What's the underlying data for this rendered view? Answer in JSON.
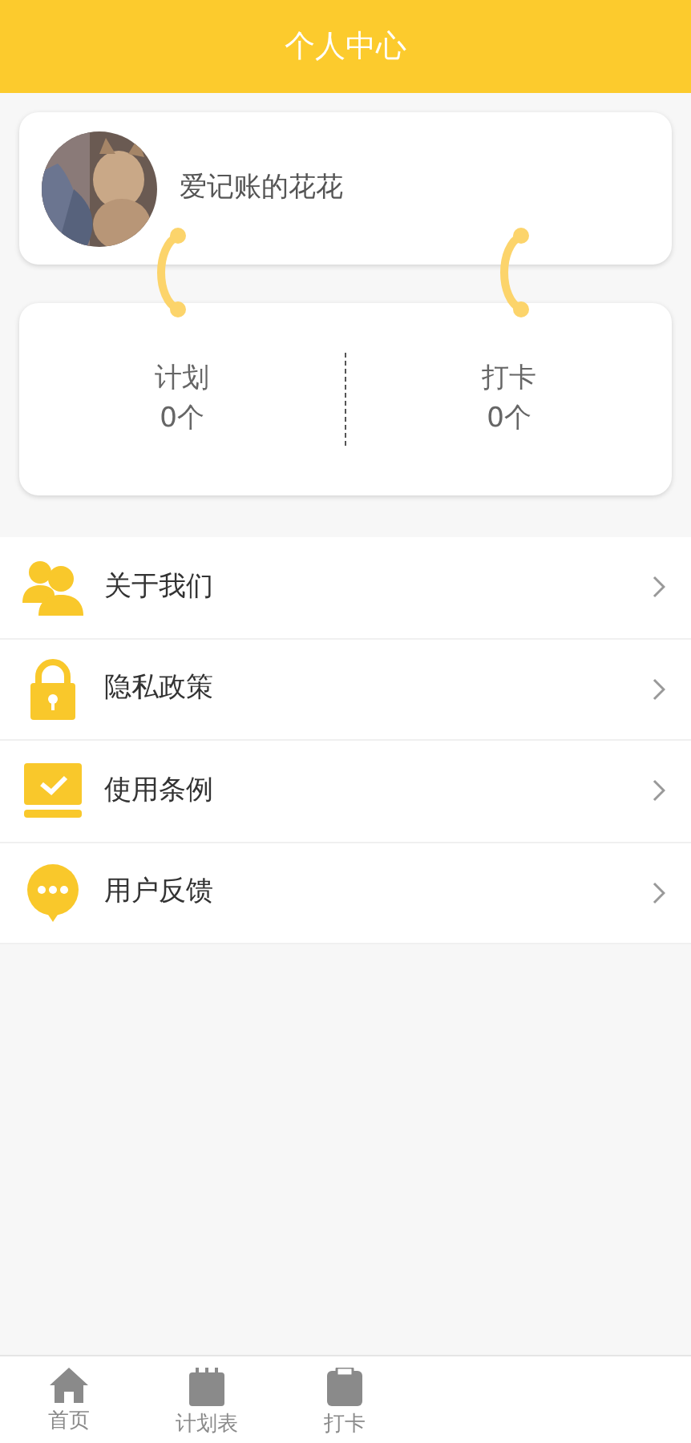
{
  "header": {
    "title": "个人中心"
  },
  "profile": {
    "name": "爱记账的花花"
  },
  "stats": [
    {
      "label": "计划",
      "value": "0个"
    },
    {
      "label": "打卡",
      "value": "0个"
    }
  ],
  "menu": [
    {
      "kind": "people",
      "label": "关于我们"
    },
    {
      "kind": "lock",
      "label": "隐私政策"
    },
    {
      "kind": "check",
      "label": "使用条例"
    },
    {
      "kind": "chat",
      "label": "用户反馈"
    }
  ],
  "tab_bar": [
    {
      "kind": "home",
      "label": "首页",
      "selected": false
    },
    {
      "kind": "calendar",
      "label": "计划表",
      "selected": false
    },
    {
      "kind": "clipboard",
      "label": "打卡",
      "selected": false
    }
  ]
}
